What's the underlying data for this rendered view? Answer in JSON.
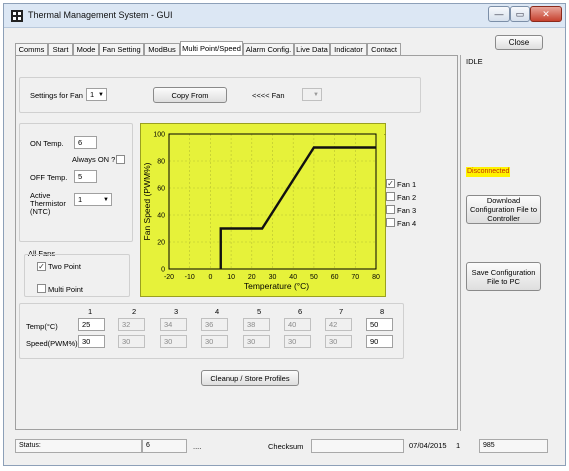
{
  "window": {
    "title": "Thermal Management System - GUI",
    "min_label": "—",
    "max_label": "▭",
    "close_label": "✕"
  },
  "close_button": "Close",
  "state": "IDLE",
  "tabs": [
    "Comms",
    "Start",
    "Mode",
    "Fan Setting",
    "ModBus",
    "Multi Point/Speed",
    "Alarm Config.",
    "Live Data",
    "Indicator",
    "Contact"
  ],
  "active_tab": "Multi Point/Speed",
  "settings": {
    "label": "Settings for Fan",
    "fan_value": "1",
    "copy_button": "Copy From",
    "arrow_label": "<<<<  Fan",
    "copy_fan_value": ""
  },
  "on_temp": {
    "label": "ON Temp.",
    "value": "6"
  },
  "always_on": {
    "label": "Always ON ?",
    "checked": false
  },
  "off_temp": {
    "label": "OFF Temp.",
    "value": "5"
  },
  "thermistor": {
    "label": "Active Thermistor (NTC)",
    "value": "1"
  },
  "all_fans": {
    "label": "All Fans",
    "two_point": {
      "label": "Two Point",
      "checked": true
    },
    "multi_point": {
      "label": "Multi Point",
      "checked": false
    }
  },
  "table": {
    "columns": [
      "1",
      "2",
      "3",
      "4",
      "5",
      "6",
      "7",
      "8"
    ],
    "temp_label": "Temp(°C)",
    "speed_label": "Speed(PWM%)",
    "temp_values": [
      "25",
      "32",
      "34",
      "36",
      "38",
      "40",
      "42",
      "50"
    ],
    "speed_values": [
      "30",
      "30",
      "30",
      "30",
      "30",
      "30",
      "30",
      "90"
    ]
  },
  "cleanup_button": "Cleanup / Store Profiles",
  "fans": [
    {
      "label": "Fan 1",
      "checked": true
    },
    {
      "label": "Fan 2",
      "checked": false
    },
    {
      "label": "Fan 3",
      "checked": false
    },
    {
      "label": "Fan 4",
      "checked": false
    }
  ],
  "connection_status": "Disconnected",
  "download_button": "Download Configuration File to Controller",
  "save_button": "Save Configuration File to PC",
  "statusbar": {
    "status_label": "Status:",
    "value1": "6",
    "dots": "....",
    "checksum_label": "Checksum",
    "date": "07/04/2015",
    "value2": "1",
    "value3": "985"
  },
  "chart_data": {
    "type": "line",
    "xlabel": "Temperature (°C)",
    "ylabel": "Fan Speed (PWM%)",
    "xlim": [
      -20,
      80
    ],
    "ylim": [
      0,
      100
    ],
    "xticks": [
      -20,
      -10,
      0,
      10,
      20,
      30,
      40,
      50,
      60,
      70,
      80
    ],
    "yticks": [
      0,
      20,
      40,
      60,
      80,
      100
    ],
    "grid": true,
    "background": "#e6f23a",
    "series": [
      {
        "x": [
          5,
          5,
          25,
          50,
          80
        ],
        "y": [
          0,
          30,
          30,
          90,
          90
        ]
      }
    ]
  }
}
